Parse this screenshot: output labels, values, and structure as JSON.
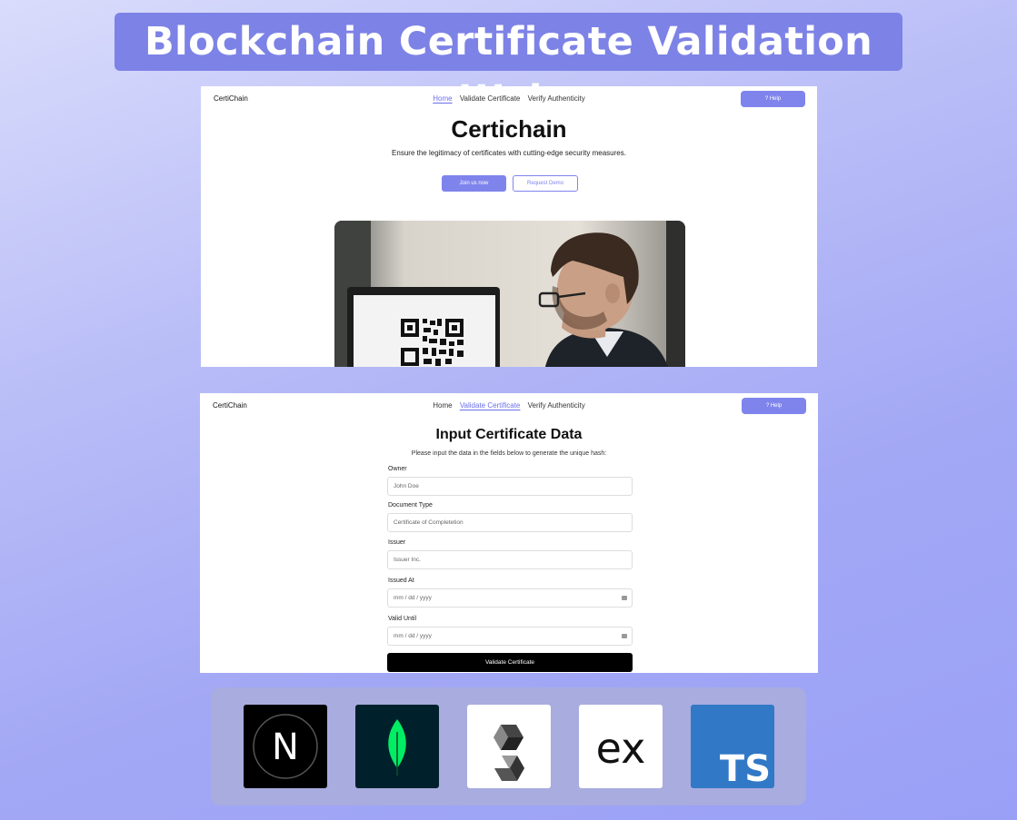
{
  "banner": {
    "title": "Blockchain Certificate Validation Web"
  },
  "panel1": {
    "brand": "CertiChain",
    "nav": [
      "Home",
      "Validate Certificate",
      "Verify Authenticity"
    ],
    "active_nav": "Home",
    "help": "? Help",
    "title": "Certichain",
    "subtitle": "Ensure the legitimacy of certificates with cutting-edge security measures.",
    "primary_button": "Join us now",
    "secondary_button": "Request Demo"
  },
  "panel2": {
    "brand": "CertiChain",
    "nav": [
      "Home",
      "Validate Certificate",
      "Verify Authenticity"
    ],
    "active_nav": "Validate Certificate",
    "help": "? Help",
    "title": "Input Certificate Data",
    "subtitle": "Please input the data in the fields below to generate the unique hash:",
    "fields": [
      {
        "label": "Owner",
        "placeholder": "John Doe"
      },
      {
        "label": "Document Type",
        "placeholder": "Certificate of Completetion"
      },
      {
        "label": "Issuer",
        "placeholder": "Issuer Inc."
      },
      {
        "label": "Issued At",
        "placeholder": "mm / dd / yyyy"
      },
      {
        "label": "Valid Until",
        "placeholder": "mm / dd / yyyy"
      }
    ],
    "submit": "Validate Certificate"
  },
  "tech_logos": {
    "next": "N",
    "mongodb": "mongodb-leaf-icon",
    "solidity": "solidity-icon",
    "express": "ex",
    "typescript": "TS"
  },
  "colors": {
    "accent": "#7f84ec",
    "banner": "#7d82e6"
  }
}
